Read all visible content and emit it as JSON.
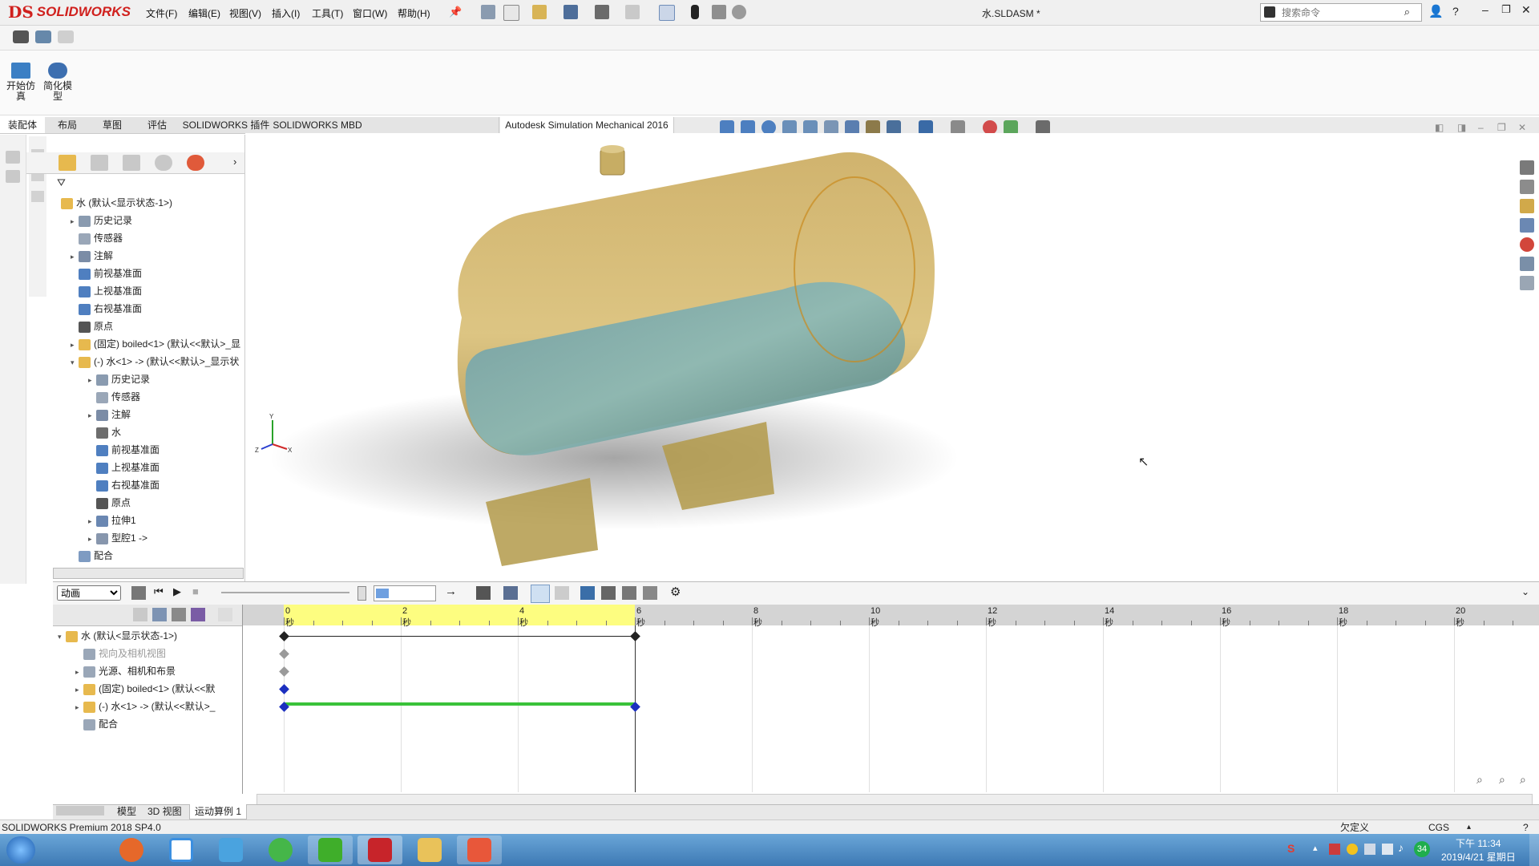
{
  "app": {
    "logo_ds": "DS",
    "logo_name": "SOLIDWORKS",
    "doc_title": "水.SLDASM *"
  },
  "menu": [
    "文件(F)",
    "编辑(E)",
    "视图(V)",
    "插入(I)",
    "工具(T)",
    "窗口(W)",
    "帮助(H)"
  ],
  "search": {
    "placeholder": "搜索命令"
  },
  "ribbon": {
    "btn1": "开始仿\n真",
    "btn2": "简化模\n型"
  },
  "tabs": [
    "装配体",
    "布局",
    "草图",
    "评估",
    "SOLIDWORKS 插件",
    "SOLIDWORKS MBD",
    "",
    "",
    "Autodesk Simulation Mechanical 2016"
  ],
  "tree": [
    {
      "label": "水  (默认<显示状态-1>)",
      "indent": 0,
      "exp": "",
      "icon": "assembly-icon"
    },
    {
      "label": "历史记录",
      "indent": 1,
      "exp": "▸",
      "icon": "history-icon"
    },
    {
      "label": "传感器",
      "indent": 1,
      "exp": "",
      "icon": "sensor-icon"
    },
    {
      "label": "注解",
      "indent": 1,
      "exp": "▸",
      "icon": "annotation-icon"
    },
    {
      "label": "前视基准面",
      "indent": 1,
      "exp": "",
      "icon": "plane-icon"
    },
    {
      "label": "上视基准面",
      "indent": 1,
      "exp": "",
      "icon": "plane-icon"
    },
    {
      "label": "右视基准面",
      "indent": 1,
      "exp": "",
      "icon": "plane-icon"
    },
    {
      "label": "原点",
      "indent": 1,
      "exp": "",
      "icon": "origin-icon"
    },
    {
      "label": "(固定) boiled<1>  (默认<<默认>_显",
      "indent": 1,
      "exp": "▸",
      "icon": "part-icon"
    },
    {
      "label": "(-) 水<1> -> (默认<<默认>_显示状",
      "indent": 1,
      "exp": "▾",
      "icon": "part-icon"
    },
    {
      "label": "历史记录",
      "indent": 2,
      "exp": "▸",
      "icon": "history-icon"
    },
    {
      "label": "传感器",
      "indent": 2,
      "exp": "",
      "icon": "sensor-icon"
    },
    {
      "label": "注解",
      "indent": 2,
      "exp": "▸",
      "icon": "annotation-icon"
    },
    {
      "label": "水",
      "indent": 2,
      "exp": "",
      "icon": "material-icon"
    },
    {
      "label": "前视基准面",
      "indent": 2,
      "exp": "",
      "icon": "plane-icon"
    },
    {
      "label": "上视基准面",
      "indent": 2,
      "exp": "",
      "icon": "plane-icon"
    },
    {
      "label": "右视基准面",
      "indent": 2,
      "exp": "",
      "icon": "plane-icon"
    },
    {
      "label": "原点",
      "indent": 2,
      "exp": "",
      "icon": "origin-icon"
    },
    {
      "label": "拉伸1",
      "indent": 2,
      "exp": "▸",
      "icon": "extrude-icon"
    },
    {
      "label": "型腔1 ->",
      "indent": 2,
      "exp": "▸",
      "icon": "cavity-icon"
    },
    {
      "label": "配合",
      "indent": 1,
      "exp": "",
      "icon": "mate-icon"
    }
  ],
  "motion": {
    "study_type": "动画",
    "tree": [
      {
        "label": "水  (默认<显示状态-1>)",
        "indent": 0,
        "exp": "▾"
      },
      {
        "label": "视向及相机视图",
        "indent": 1,
        "exp": ""
      },
      {
        "label": "光源、相机和布景",
        "indent": 1,
        "exp": "▸"
      },
      {
        "label": "(固定) boiled<1>  (默认<<默",
        "indent": 1,
        "exp": "▸"
      },
      {
        "label": "(-) 水<1> -> (默认<<默认>_",
        "indent": 1,
        "exp": "▸"
      },
      {
        "label": "配合",
        "indent": 1,
        "exp": ""
      }
    ],
    "ruler": [
      "0 秒",
      "2 秒",
      "4 秒",
      "6 秒",
      "8 秒",
      "10 秒",
      "12 秒",
      "14 秒",
      "16 秒",
      "18 秒",
      "20 秒"
    ],
    "timebar_seconds": 6
  },
  "bottom_tabs": [
    "模型",
    "3D 视图",
    "运动算例 1"
  ],
  "status": {
    "product": "SOLIDWORKS Premium 2018 SP4.0",
    "state": "欠定义",
    "units": "CGS"
  },
  "clock": {
    "time": "下午 11:34",
    "date": "2019/4/21 星期日"
  },
  "colors": {
    "accent_red": "#d0201d",
    "tank": "#d4b768",
    "water": "#5f8f8a",
    "timebar": "#fdfd80",
    "track": "#39c239",
    "key_blue": "#1b2fbf"
  }
}
